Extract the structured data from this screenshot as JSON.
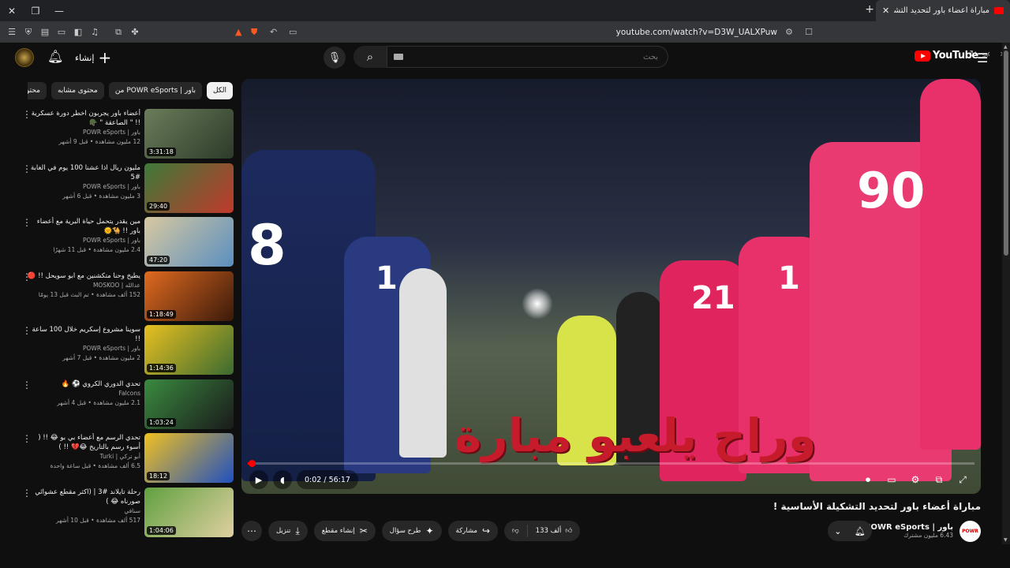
{
  "browser": {
    "tab_title": "مباراة أعضاء باور لتحديد التشكيلة !!",
    "url": "youtube.com/watch?v=D3W_UALXPuw"
  },
  "header": {
    "create_label": "إنشاء",
    "search_placeholder": "بحث",
    "logo_text": "YouTube",
    "logo_region": "SA"
  },
  "chips": [
    {
      "label": "الكل",
      "active": true
    },
    {
      "label": "من POWR eSports | باور",
      "active": false
    },
    {
      "label": "محتوى مشابه",
      "active": false
    },
    {
      "label": "محتو",
      "active": false
    }
  ],
  "recommendations": [
    {
      "title": "أعضاء باور يجربون اخطر دورة عسكرية !! \" الصاعقة \" 🪖",
      "channel": "باور | POWR eSports",
      "stats": "12 مليون مشاهدة • قبل 9 أشهر",
      "duration": "3:31:18",
      "thumb_colors": [
        "#6b7d5a",
        "#2d3a2a"
      ]
    },
    {
      "title": "مليون ريال اذا عشنا 100 يوم في الغابة #5",
      "channel": "باور | POWR eSports",
      "stats": "3 مليون مشاهدة • قبل 6 أشهر",
      "duration": "29:40",
      "thumb_colors": [
        "#3d7a3a",
        "#c0392b"
      ]
    },
    {
      "title": "مين يقدر يتحمل حياة البرية مع أعضاء باور !! 🐪🌞",
      "channel": "باور | POWR eSports",
      "stats": "2.4 مليون مشاهدة • قبل 11 شهرًا",
      "duration": "47:20",
      "thumb_colors": [
        "#d8c8a0",
        "#5a8fc0"
      ]
    },
    {
      "title": "يطبخ وحنا متكشنين مع ابو سويحل !! 🔴",
      "channel": "عدالله | MOSKOO",
      "stats": "152 ألف مشاهدة • تم البث قبل 13 يومًا",
      "duration": "1:18:49",
      "thumb_colors": [
        "#e06a20",
        "#3a1a0a"
      ]
    },
    {
      "title": "سوينا مشروع إسكريم خلال 100 ساعة !!",
      "channel": "باور | POWR eSports",
      "stats": "2 مليون مشاهدة • قبل 7 أشهر",
      "duration": "1:14:36",
      "thumb_colors": [
        "#e8c020",
        "#3a6a30"
      ]
    },
    {
      "title": "تحدي الدوري الكروي ⚽️ 🔥",
      "channel": "Falcons",
      "stats": "2.1 مليون مشاهدة • قبل 4 أشهر",
      "duration": "1:03:24",
      "thumb_colors": [
        "#3a8a40",
        "#1a1a1a"
      ]
    },
    {
      "title": "تحدي الرسم مع أعضاء بي بو 😂 !! ( أسوء رسم بالتاريخ 😂💔 !! )",
      "channel": "أبو تركي | Turki",
      "stats": "6.5 ألف مشاهدة • قبل ساعة واحدة",
      "duration": "18:12",
      "thumb_colors": [
        "#f0c020",
        "#2050c0"
      ]
    },
    {
      "title": "رحلة تايلاند #3 | (اكثر مقطع عشوائي صورناه 😂 )",
      "channel": "سنافي",
      "stats": "517 ألف مشاهدة • قبل 10 أشهر",
      "duration": "1:04:06",
      "thumb_colors": [
        "#60a040",
        "#e0d0a0"
      ]
    }
  ],
  "player": {
    "caption": "وراح يلعبو مبارة",
    "time": "0:02 / 56:17",
    "progress": 0.0006,
    "player_numbers": [
      "8",
      "1",
      "90",
      "21",
      "1"
    ]
  },
  "video": {
    "title": "مباراة أعضاء باور لتحديد التشكيلة الأساسية !",
    "channel_name": "باور | POWR eSports",
    "channel_subs": "6.43 مليون مشترك",
    "channel_avatar_text": "POWR",
    "likes": "133 ألف",
    "share_label": "مشاركة",
    "ask_label": "طرح سؤال",
    "clip_label": "إنشاء مقطع",
    "download_label": "تنزيل"
  }
}
